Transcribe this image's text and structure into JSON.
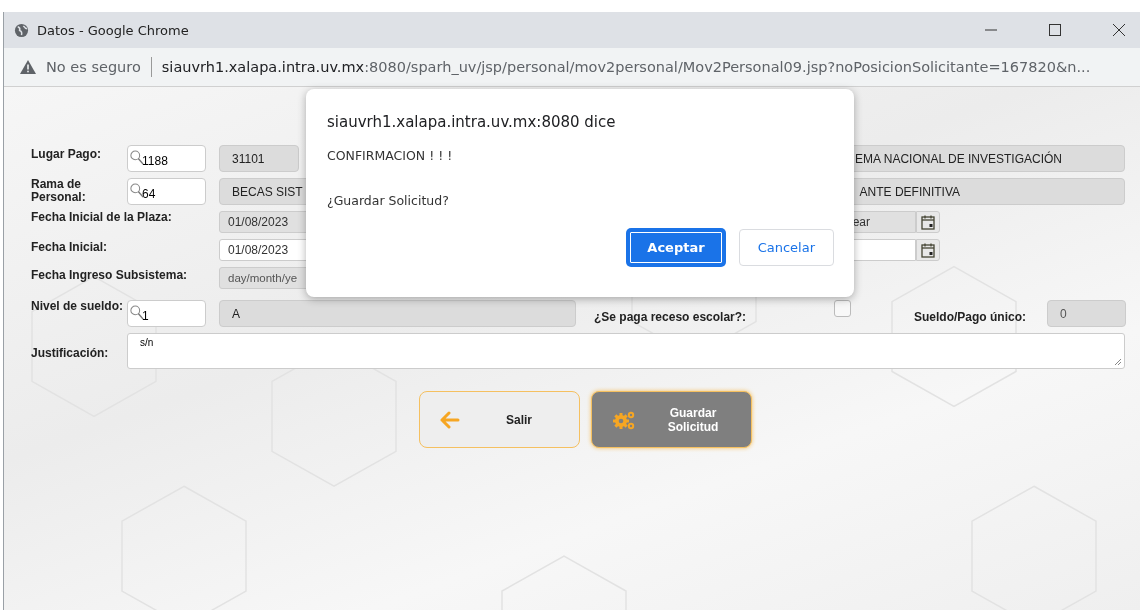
{
  "window": {
    "title": "Datos - Google Chrome"
  },
  "address_bar": {
    "security": "No es seguro",
    "url_host": "siauvrh1.xalapa.intra.uv.mx",
    "url_rest": ":8080/sparh_uv/jsp/personal/mov2personal/Mov2Personal09.jsp?noPosicionSolicitante=167820&n..."
  },
  "form": {
    "lugar_pago": {
      "label": "Lugar Pago:",
      "code": "1188",
      "key": "31101",
      "description_tail": "EMA NACIONAL DE INVESTIGACIÓN"
    },
    "rama_personal": {
      "label": "Rama de Personal:",
      "code": "64",
      "description_head": "BECAS SIST",
      "description_tail": "ANTE DEFINITIVA"
    },
    "fecha_inicial_plaza": {
      "label": "Fecha Inicial de la Plaza:",
      "value": "01/08/2023",
      "end_tail": "ear"
    },
    "fecha_inicial": {
      "label": "Fecha Inicial:",
      "value": "01/08/2023"
    },
    "fecha_ingreso": {
      "label": "Fecha Ingreso Subsistema:",
      "placeholder": "day/month/ye"
    },
    "nivel_sueldo": {
      "label": "Nivel de sueldo:",
      "code": "1",
      "description": "A"
    },
    "receso": {
      "label": "¿Se paga receso escolar?:",
      "checked": false
    },
    "sueldo_pago_unico": {
      "label": "Sueldo/Pago único:",
      "value": "0"
    },
    "justificacion": {
      "label": "Justificación:",
      "value": "s/n"
    }
  },
  "buttons": [
    {
      "kind": "exit",
      "label": "Salir"
    },
    {
      "kind": "save",
      "label": "Guardar Solicitud"
    }
  ],
  "dialog": {
    "title": "siauvrh1.xalapa.intra.uv.mx:8080 dice",
    "message": "CONFIRMACION ! ! !",
    "question": "¿Guardar Solicitud?",
    "buttons": [
      {
        "kind": "primary",
        "label": "Aceptar"
      },
      {
        "kind": "secondary",
        "label": "Cancelar"
      }
    ]
  }
}
